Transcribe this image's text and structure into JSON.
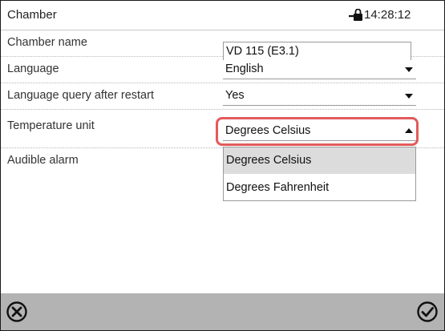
{
  "header": {
    "title": "Chamber",
    "time": "14:28:12",
    "lock_icon": "lock-icon"
  },
  "rows": [
    {
      "label": "Chamber name",
      "value": "VD 115 (E3.1)"
    },
    {
      "label": "Language",
      "value": "English"
    },
    {
      "label": "Language query after restart",
      "value": "Yes"
    },
    {
      "label": "Temperature unit",
      "value": "Degrees Celsius"
    },
    {
      "label": "Audible alarm"
    }
  ],
  "dropdown": {
    "options": [
      "Degrees Celsius",
      "Degrees Fahrenheit"
    ],
    "selected": "Degrees Celsius"
  },
  "footer": {
    "cancel_icon": "cancel-icon",
    "confirm_icon": "confirm-icon"
  },
  "colors": {
    "focus": "#e35a5a",
    "footer_bg": "#b3b3b3",
    "selected_option_bg": "#dcdcdc"
  }
}
